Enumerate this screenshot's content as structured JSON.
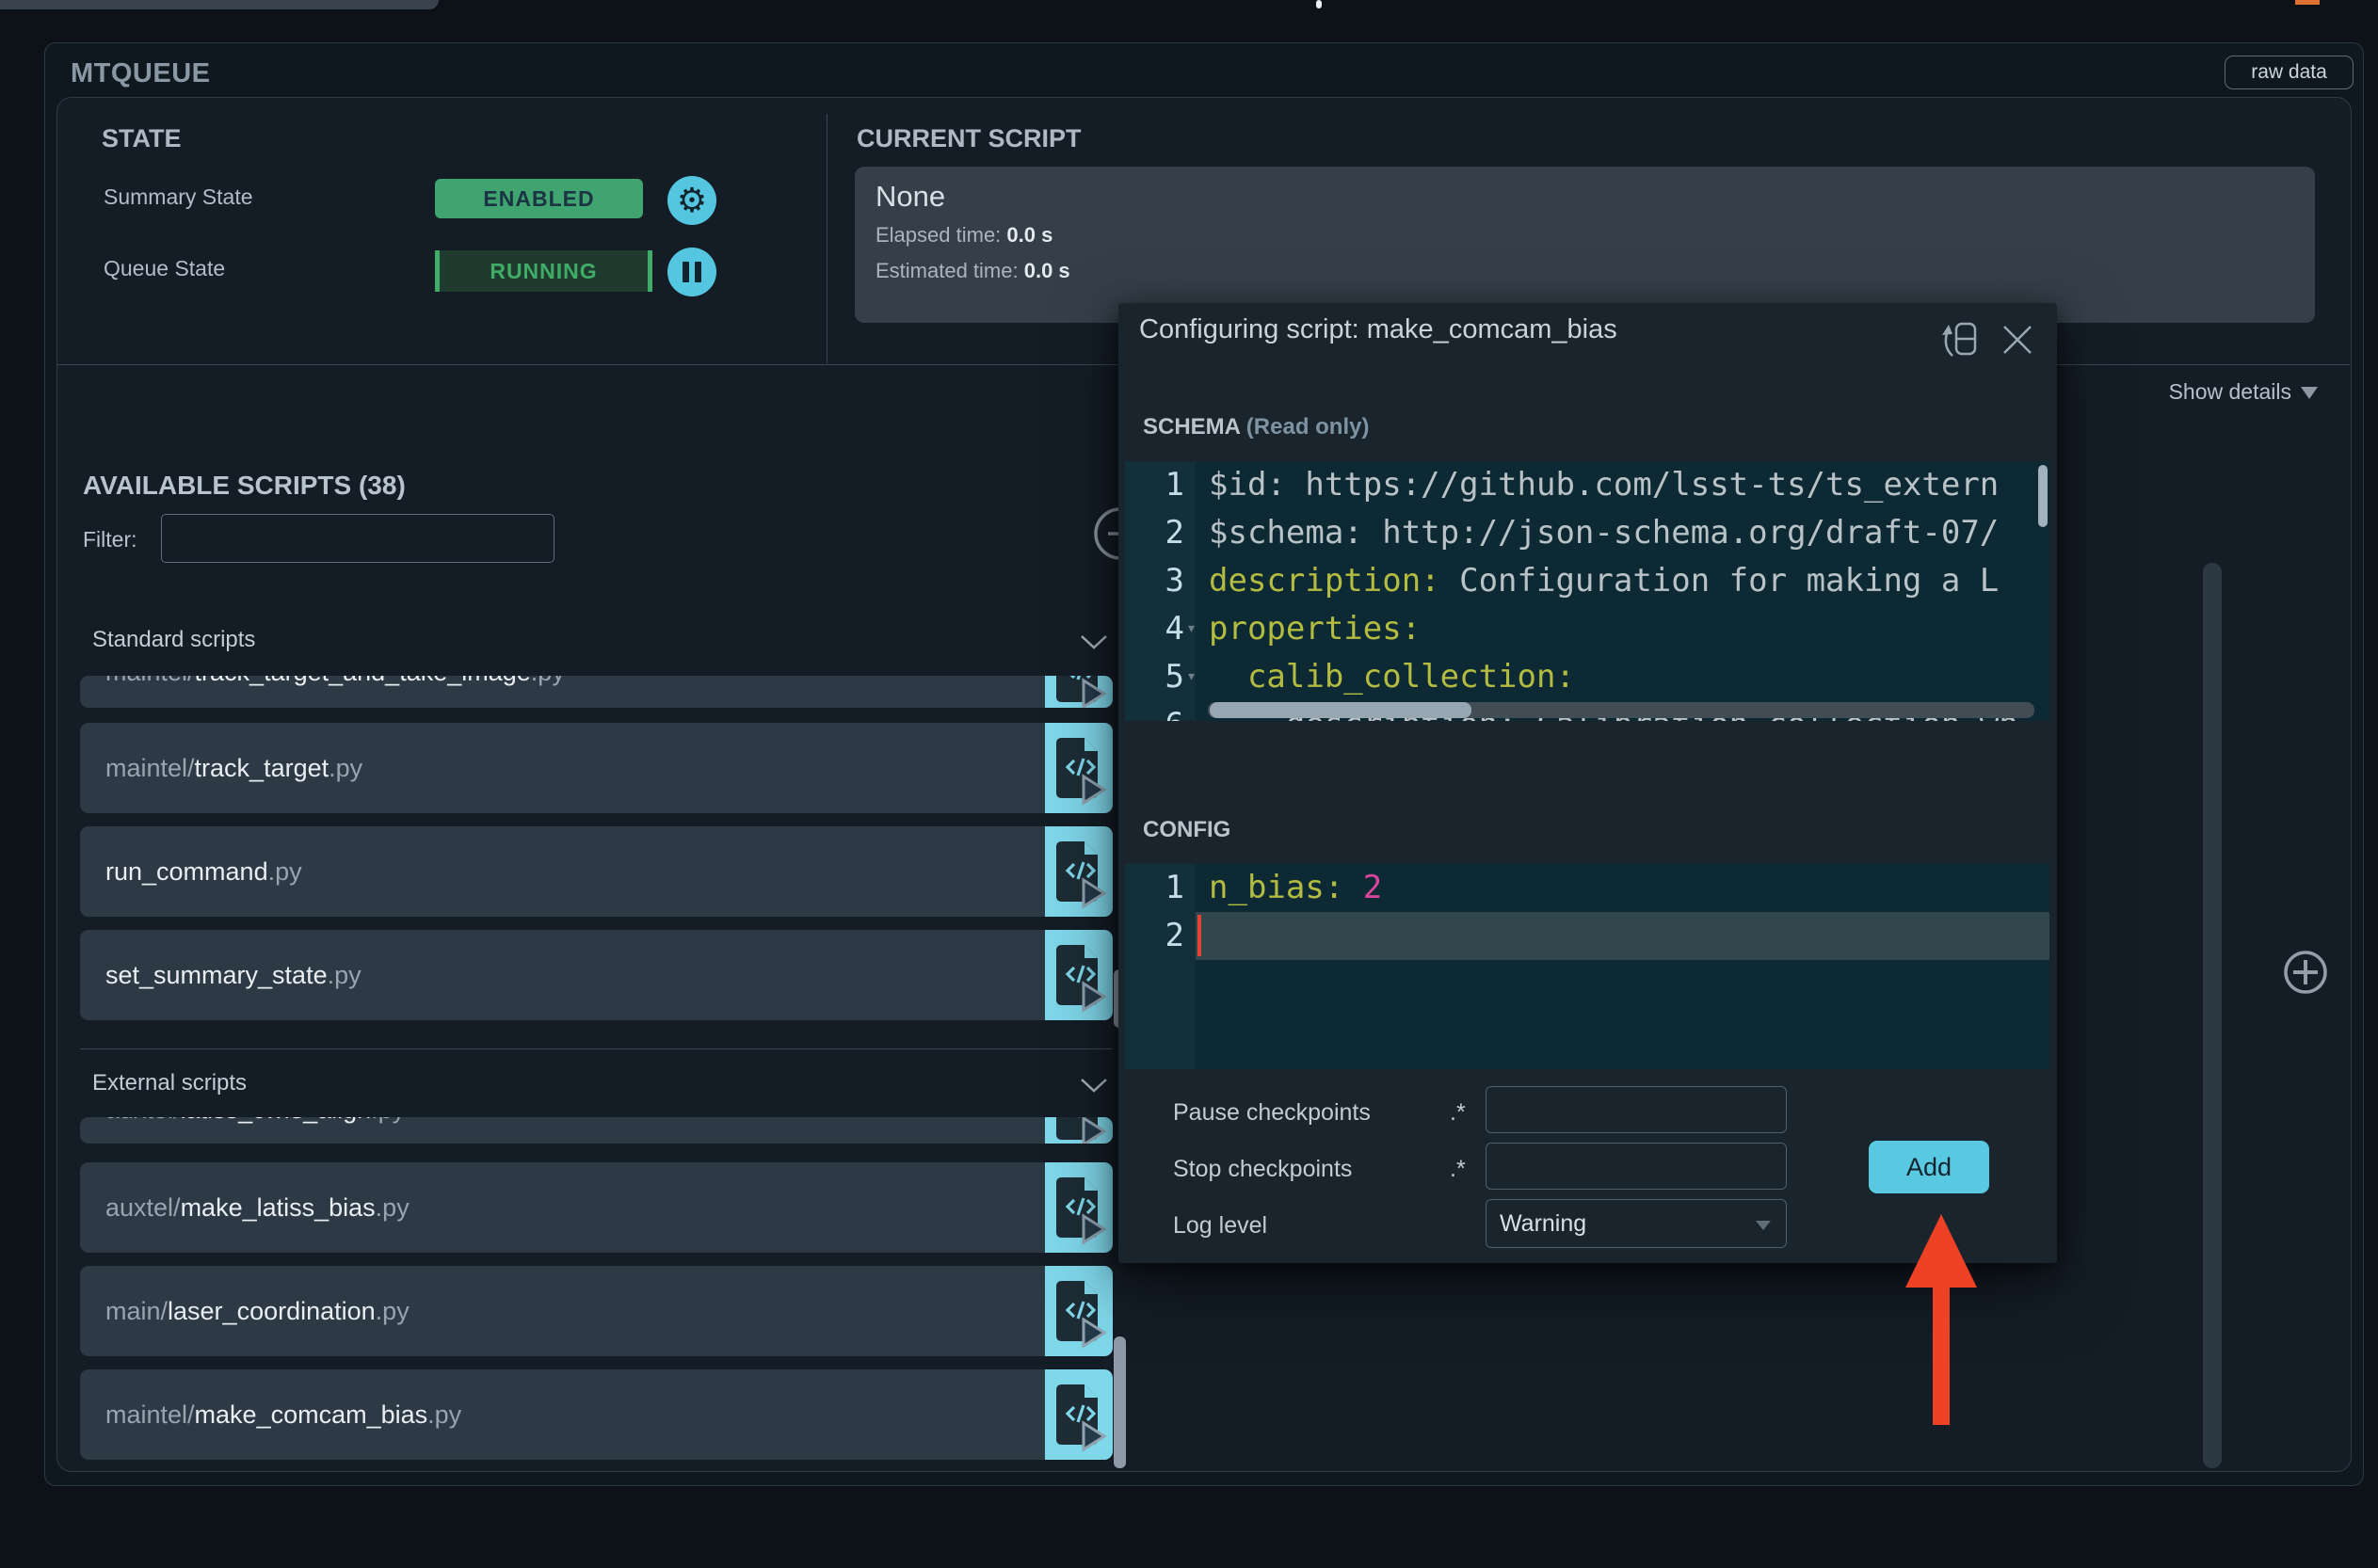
{
  "header": {
    "title": "MTQUEUE",
    "raw_data": "raw data"
  },
  "state": {
    "title": "STATE",
    "summary_label": "Summary State",
    "summary_value": "ENABLED",
    "queue_label": "Queue State",
    "queue_value": "RUNNING"
  },
  "current_script": {
    "title": "CURRENT SCRIPT",
    "name": "None",
    "elapsed_label": "Elapsed time:",
    "elapsed_value": "0.0 s",
    "estimated_label": "Estimated time:",
    "estimated_value": "0.0 s",
    "show_details": "Show details"
  },
  "available": {
    "title": "AVAILABLE SCRIPTS (38)",
    "filter_label": "Filter:",
    "filter_value": "",
    "groups": [
      {
        "label": "Standard scripts",
        "clipped_item": {
          "prefix": "maintel/",
          "name": "track_target_and_take_image",
          "ext": ".py"
        },
        "items": [
          {
            "prefix": "maintel/",
            "name": "track_target",
            "ext": ".py"
          },
          {
            "prefix": "",
            "name": "run_command",
            "ext": ".py"
          },
          {
            "prefix": "",
            "name": "set_summary_state",
            "ext": ".py"
          }
        ]
      },
      {
        "label": "External scripts",
        "clipped_item": {
          "prefix": "auxtel/",
          "name": "latiss_cwfs_align",
          "ext": ".py"
        },
        "items": [
          {
            "prefix": "auxtel/",
            "name": "make_latiss_bias",
            "ext": ".py"
          },
          {
            "prefix": "main/",
            "name": "laser_coordination",
            "ext": ".py"
          },
          {
            "prefix": "maintel/",
            "name": "make_comcam_bias",
            "ext": ".py"
          }
        ]
      }
    ]
  },
  "modal": {
    "title": "Configuring script: make_comcam_bias",
    "schema_title": "SCHEMA",
    "schema_readonly": "(Read only)",
    "schema_lines": [
      {
        "n": "1",
        "fold": false,
        "parts": [
          {
            "c": "plain",
            "t": "$id: https://github.com/lsst-ts/ts_extern"
          }
        ]
      },
      {
        "n": "2",
        "fold": false,
        "parts": [
          {
            "c": "plain",
            "t": "$schema: http://json-schema.org/draft-07/"
          }
        ]
      },
      {
        "n": "3",
        "fold": false,
        "parts": [
          {
            "c": "key",
            "t": "description:"
          },
          {
            "c": "plain",
            "t": " Configuration for making a L"
          }
        ]
      },
      {
        "n": "4",
        "fold": true,
        "parts": [
          {
            "c": "key",
            "t": "properties:"
          }
        ]
      },
      {
        "n": "5",
        "fold": true,
        "parts": [
          {
            "c": "key",
            "t": "  calib_collection:"
          }
        ]
      },
      {
        "n": "6",
        "fold": true,
        "parts": [
          {
            "c": "plain",
            "t": "    description: Calibration collection wh"
          }
        ]
      }
    ],
    "config_title": "CONFIG",
    "config_lines": [
      {
        "n": "1",
        "active": false,
        "cursor": false,
        "parts": [
          {
            "c": "key",
            "t": "n_bias:"
          },
          {
            "c": "plain",
            "t": " "
          },
          {
            "c": "num",
            "t": "2"
          }
        ]
      },
      {
        "n": "2",
        "active": true,
        "cursor": true,
        "parts": []
      }
    ],
    "form": {
      "pause_label": "Pause checkpoints",
      "pause_regex": ".*",
      "pause_value": "",
      "stop_label": "Stop checkpoints",
      "stop_regex": ".*",
      "stop_value": "",
      "log_label": "Log level",
      "log_value": "Warning",
      "add_button": "Add"
    }
  },
  "icons": {
    "gear": "⚙",
    "pause": "pause-bars",
    "settings_circle": "cyan-circle",
    "circle_minus": "⊖",
    "circle_plus": "⊕",
    "chevron_down": "∨",
    "show_details_caret": "▼",
    "dropdown_caret": "▼",
    "modal_flip": "flip-panel",
    "modal_close": "✕",
    "script_run": "file-code-play"
  },
  "colors": {
    "accent_cyan": "#54c6df",
    "run_button_cyan": "#7fd7ea",
    "enabled_green": "#3fa470",
    "running_green": "#41ac67",
    "arrow_red": "#ee4125",
    "code_key_yellow": "#b3bb41",
    "code_value_pink": "#d8459c",
    "editor_bg": "#0d2a34",
    "panel_bg": "#141d26",
    "modal_bg": "#1a242d"
  }
}
